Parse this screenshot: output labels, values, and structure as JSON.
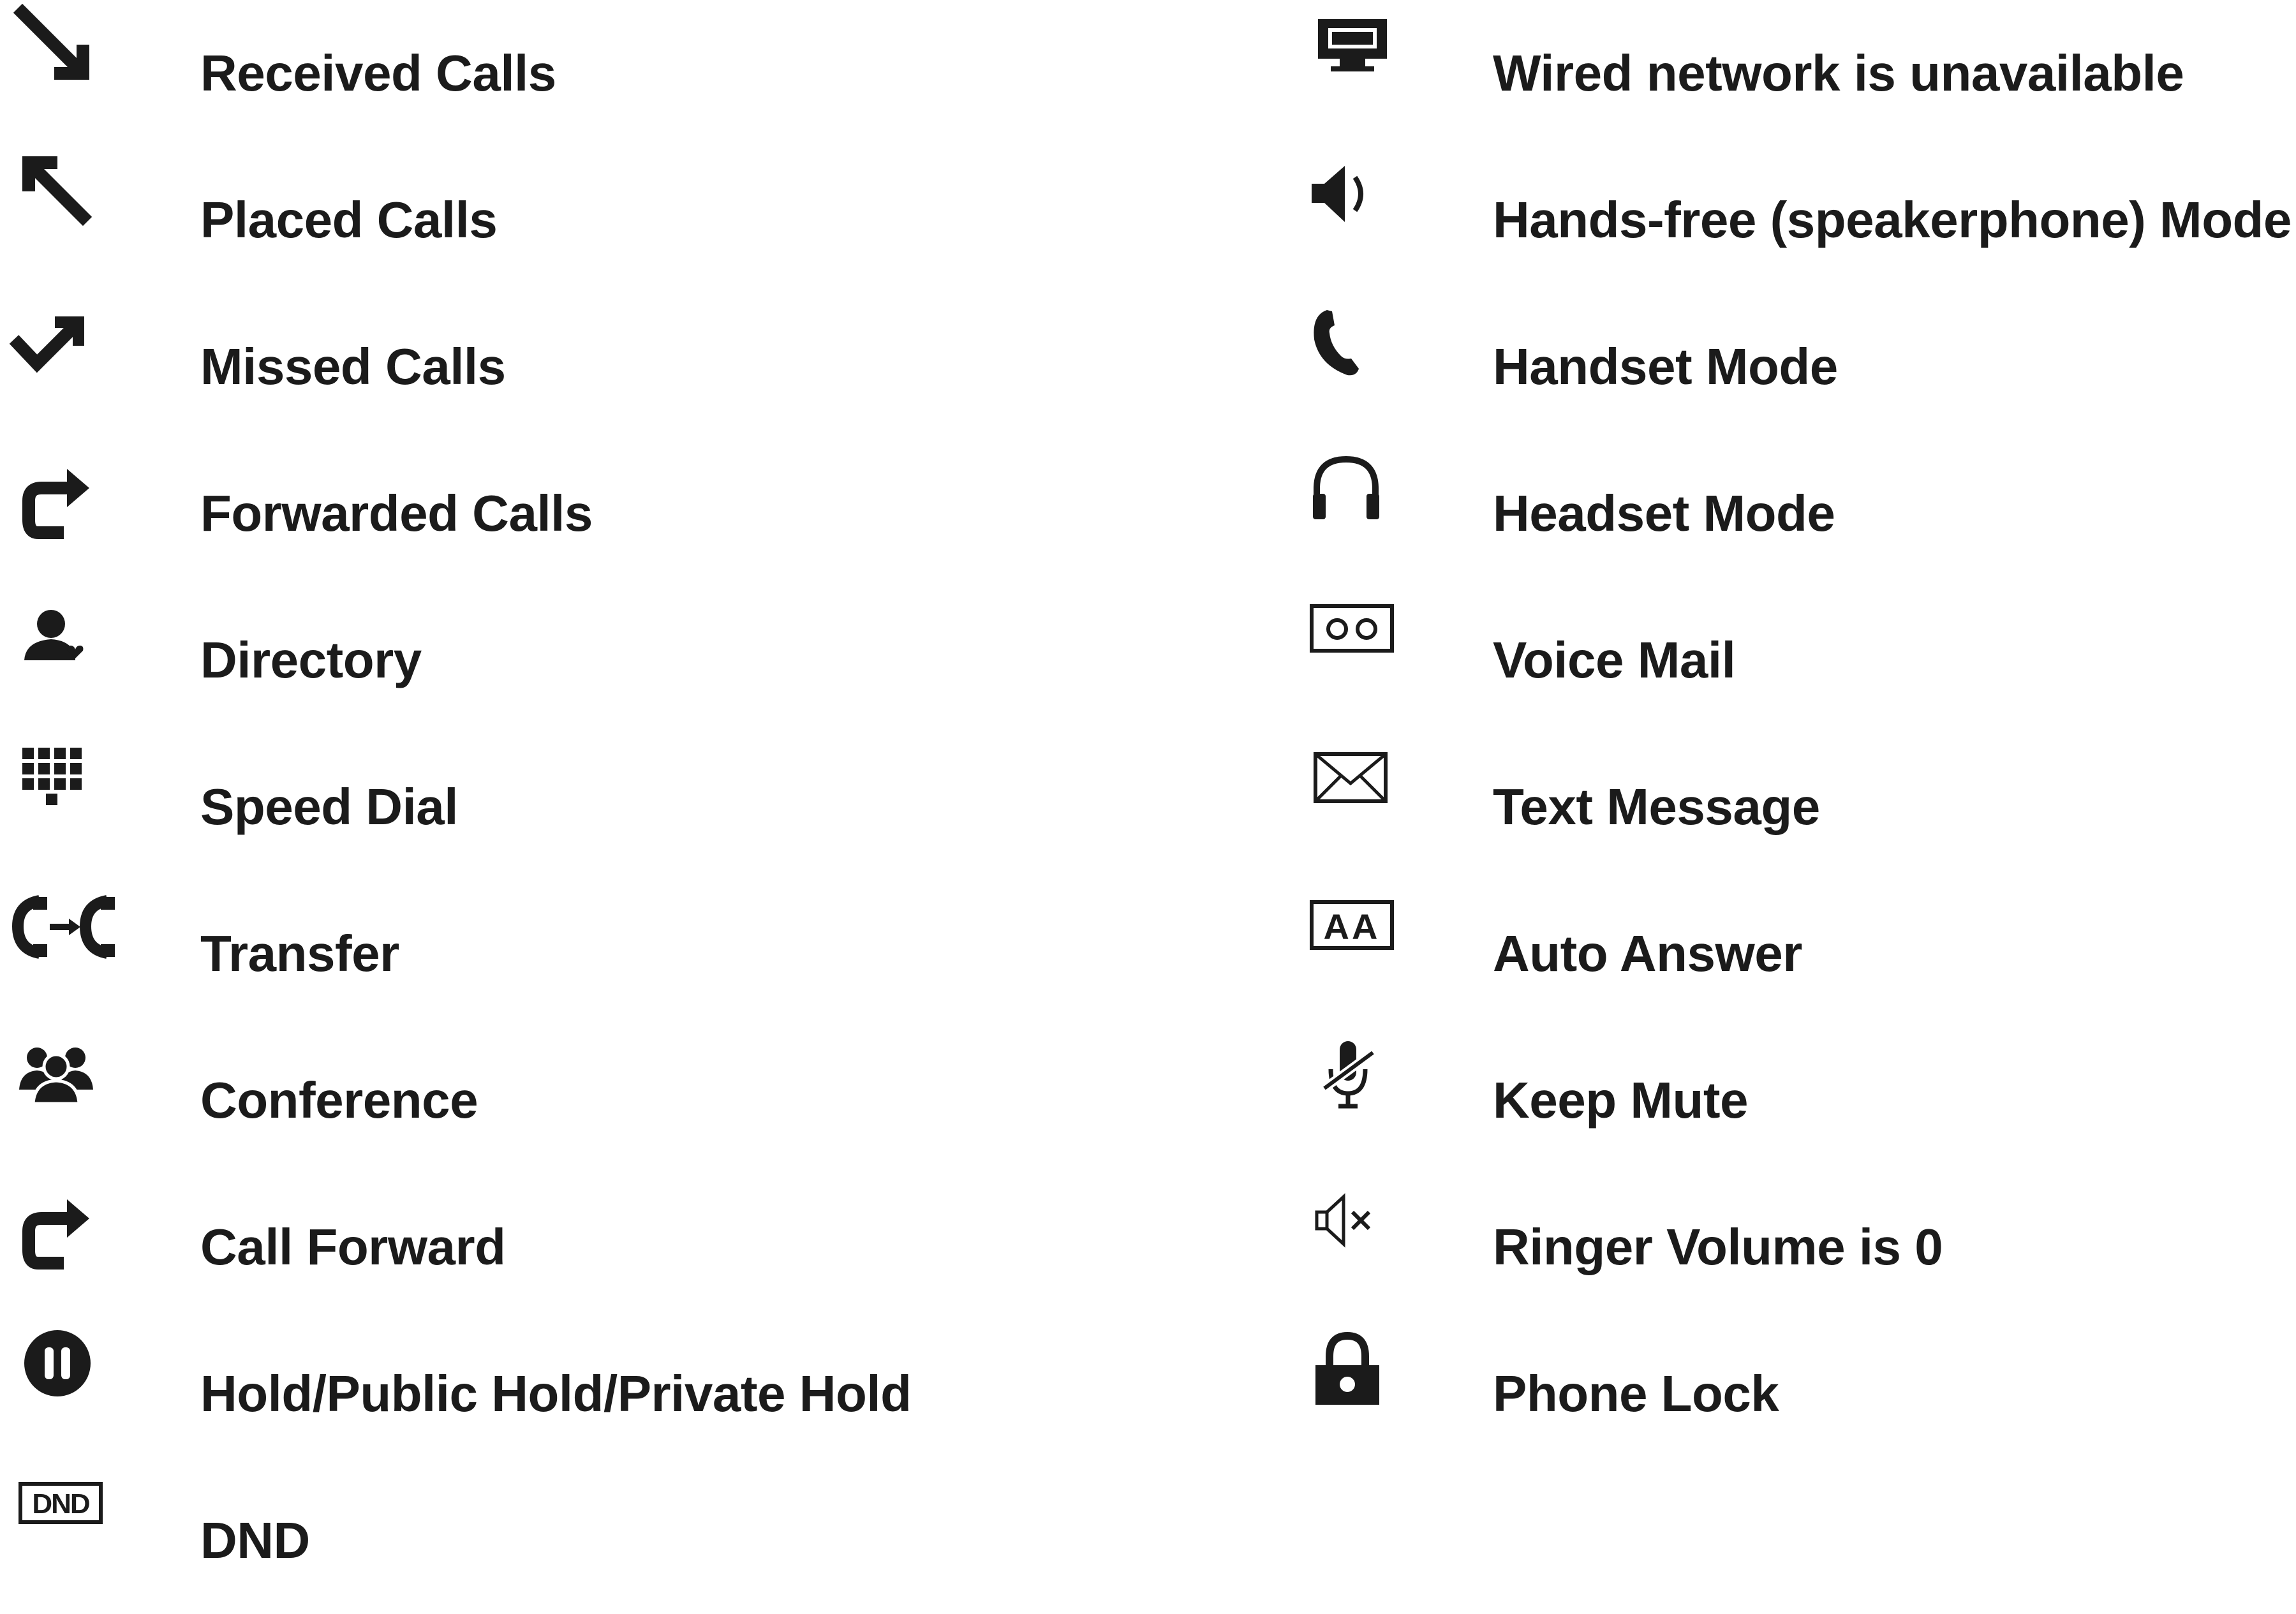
{
  "legend": {
    "left": [
      {
        "label": "Received Calls",
        "icon": "received-calls-icon"
      },
      {
        "label": "Placed Calls",
        "icon": "placed-calls-icon"
      },
      {
        "label": "Missed Calls",
        "icon": "missed-calls-icon"
      },
      {
        "label": "Forwarded Calls",
        "icon": "forwarded-calls-icon"
      },
      {
        "label": "Directory",
        "icon": "directory-icon"
      },
      {
        "label": "Speed Dial",
        "icon": "speed-dial-icon"
      },
      {
        "label": "Transfer",
        "icon": "transfer-icon"
      },
      {
        "label": "Conference",
        "icon": "conference-icon"
      },
      {
        "label": "Call Forward",
        "icon": "call-forward-icon"
      },
      {
        "label": "Hold/Public Hold/Private Hold",
        "icon": "hold-icon"
      },
      {
        "label": "DND",
        "icon": "dnd-icon",
        "icon_text": "DND"
      }
    ],
    "right": [
      {
        "label": "Wired network is unavailable",
        "icon": "wired-network-unavailable-icon"
      },
      {
        "label": "Hands-free (speakerphone) Mode",
        "icon": "speakerphone-icon"
      },
      {
        "label": "Handset Mode",
        "icon": "handset-icon"
      },
      {
        "label": "Headset Mode",
        "icon": "headset-icon"
      },
      {
        "label": "Voice Mail",
        "icon": "voice-mail-icon"
      },
      {
        "label": "Text Message",
        "icon": "text-message-icon"
      },
      {
        "label": "Auto Answer",
        "icon": "auto-answer-icon",
        "icon_text": "AA"
      },
      {
        "label": "Keep Mute",
        "icon": "keep-mute-icon"
      },
      {
        "label": "Ringer Volume is 0",
        "icon": "ringer-volume-zero-icon"
      },
      {
        "label": "Phone Lock",
        "icon": "phone-lock-icon"
      }
    ]
  },
  "colors": {
    "text": "#1b1b1b",
    "icon": "#1b1b1b",
    "background": "#ffffff"
  }
}
